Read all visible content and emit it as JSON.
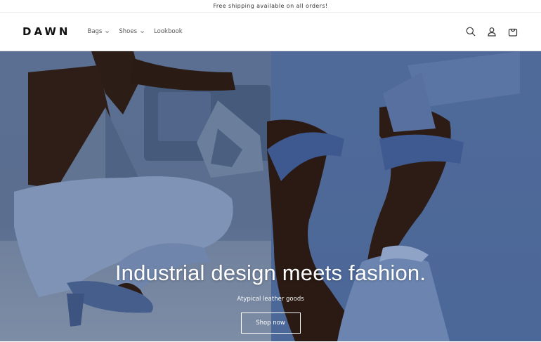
{
  "announcement": {
    "text": "Free shipping available on all orders!"
  },
  "header": {
    "logo": "DAWN",
    "nav": [
      {
        "label": "Bags",
        "has_dropdown": true
      },
      {
        "label": "Shoes",
        "has_dropdown": true
      },
      {
        "label": "Lookbook",
        "has_dropdown": false
      }
    ],
    "icons": [
      "search-icon",
      "account-icon",
      "cart-icon"
    ]
  },
  "hero": {
    "title": "Industrial design meets fashion.",
    "subtitle": "Atypical leather goods",
    "button_label": "Shop now"
  },
  "colors": {
    "hero_blue": "#4f6a99",
    "hero_slate": "#5a6f92",
    "text": "#121212"
  }
}
